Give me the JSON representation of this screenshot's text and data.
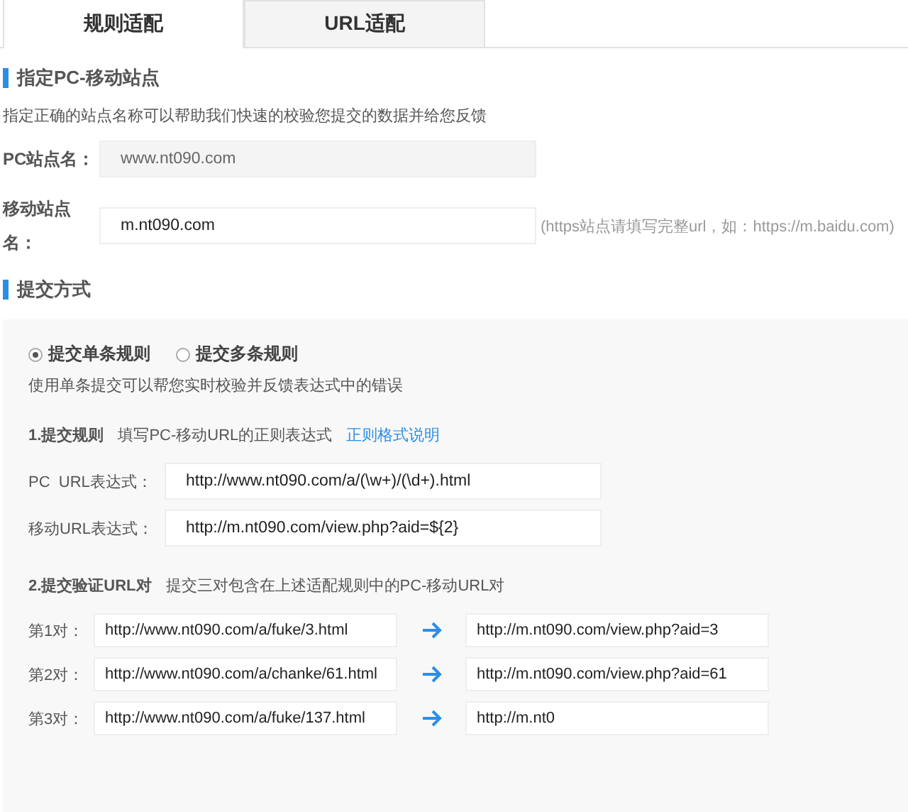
{
  "tabs": [
    {
      "label": "规则适配",
      "selected": true
    },
    {
      "label": "URL适配",
      "selected": false
    }
  ],
  "site_section": {
    "heading": "指定PC-移动站点",
    "description": "指定正确的站点名称可以帮助我们快速的校验您提交的数据并给您反馈",
    "fields": [
      {
        "label": "PC站点名：",
        "value": "www.nt090.com",
        "disabled": true
      },
      {
        "label": "移动站点名：",
        "value": "m.nt090.com",
        "disabled": false,
        "hint": "(https站点请填写完整url，如：https://m.baidu.com)"
      }
    ]
  },
  "submit_section": {
    "heading": "提交方式",
    "modes": [
      {
        "label": "提交单条规则",
        "selected": true
      },
      {
        "label": "提交多条规则",
        "selected": false
      }
    ],
    "mode_description": "使用单条提交可以帮您实时校验并反馈表达式中的错误",
    "rules": {
      "title": "1.提交规则",
      "note": "填写PC-移动URL的正则表达式",
      "link": "正则格式说明",
      "fields": [
        {
          "label": "PC  URL表达式：",
          "value": "http://www.nt090.com/a/(\\w+)/(\\d+).html"
        },
        {
          "label": "移动URL表达式：",
          "value": "http://m.nt090.com/view.php?aid=${2}"
        }
      ]
    },
    "pairs": {
      "title": "2.提交验证URL对",
      "note": "提交三对包含在上述适配规则中的PC-移动URL对",
      "rows": [
        {
          "label": "第1对：",
          "pc": "http://www.nt090.com/a/fuke/3.html",
          "mobile": "http://m.nt090.com/view.php?aid=3"
        },
        {
          "label": "第2对：",
          "pc": "http://www.nt090.com/a/chanke/61.html",
          "mobile": "http://m.nt090.com/view.php?aid=61"
        },
        {
          "label": "第3对：",
          "pc": "http://www.nt090.com/a/fuke/137.html",
          "mobile": "http://m.nt0"
        }
      ]
    }
  }
}
